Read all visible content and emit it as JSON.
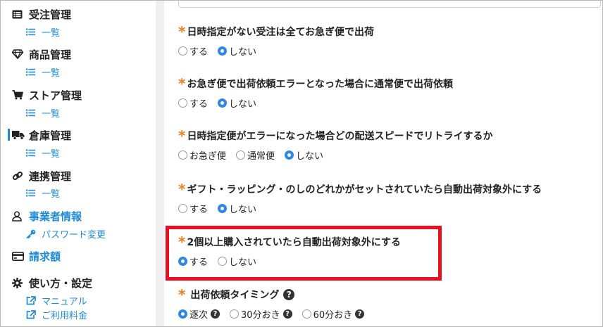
{
  "sidebar": {
    "sections": [
      {
        "title": "受注管理",
        "icon": "list-alt-icon",
        "sub": "一覧",
        "sub_icon": "list-icon"
      },
      {
        "title": "商品管理",
        "icon": "diamond-icon",
        "sub": "一覧",
        "sub_icon": "list-icon"
      },
      {
        "title": "ストア管理",
        "icon": "shopping-cart-icon",
        "sub": "一覧",
        "sub_icon": "list-icon"
      },
      {
        "title": "倉庫管理",
        "icon": "truck-icon",
        "sub": "一覧",
        "sub_icon": "list-icon"
      },
      {
        "title": "連携管理",
        "icon": "link-icon",
        "sub": "一覧",
        "sub_icon": "list-icon"
      },
      {
        "title": "事業者情報",
        "icon": "user-icon",
        "sub": "パスワード変更",
        "sub_icon": "key-icon"
      },
      {
        "title": "請求額",
        "icon": "credit-card-icon"
      },
      {
        "title": "使い方・設定",
        "icon": "gear-icon",
        "links": [
          "マニュアル",
          "ご利用料金"
        ],
        "link_icon": "external-link-icon"
      }
    ]
  },
  "settings": [
    {
      "title": "日時指定がない受注は全てお急ぎ便で出荷",
      "options": [
        "する",
        "しない"
      ],
      "selected": "しない"
    },
    {
      "title": "お急ぎ便で出荷依頼エラーとなった場合に通常便で出荷依頼",
      "options": [
        "する",
        "しない"
      ],
      "selected": "しない"
    },
    {
      "title": "日時指定便がエラーになった場合どの配送スピードでリトライするか",
      "options": [
        "お急ぎ便",
        "通常便",
        "しない"
      ],
      "selected": "しない"
    },
    {
      "title": "ギフト・ラッピング・のしのどれかがセットされていたら自動出荷対象外にする",
      "options": [
        "する",
        "しない"
      ],
      "selected": "しない"
    },
    {
      "title": "2個以上購入されていたら自動出荷対象外にする",
      "options": [
        "する",
        "しない"
      ],
      "selected": "する"
    },
    {
      "title": "出荷依頼タイミング",
      "options": [
        "逐次",
        "30分おき",
        "60分おき"
      ],
      "selected": "逐次"
    }
  ],
  "colors": {
    "accent": "#1f8ad9",
    "asterisk": "#f07d1a",
    "highlight": "#e8101e",
    "radio_on": "#2f86e8"
  }
}
